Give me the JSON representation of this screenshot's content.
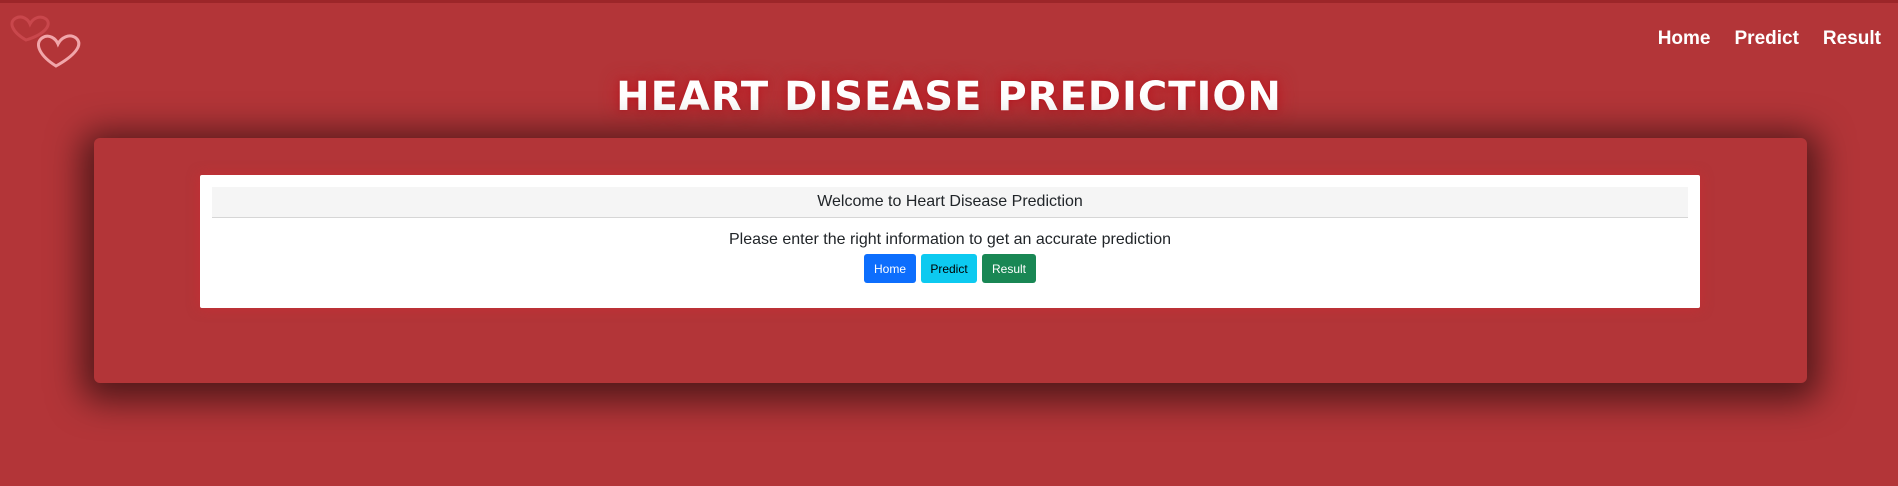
{
  "logo": {
    "icon": "heart-outline-icon"
  },
  "nav": {
    "items": [
      {
        "label": "Home"
      },
      {
        "label": "Predict"
      },
      {
        "label": "Result"
      }
    ]
  },
  "page": {
    "title": "HEART DISEASE PREDICTION"
  },
  "card": {
    "header": "Welcome to Heart Disease Prediction",
    "text": "Please enter the right information to get an accurate prediction",
    "buttons": [
      {
        "label": "Home",
        "color": "#0d6efd"
      },
      {
        "label": "Predict",
        "color": "#0dcaf0"
      },
      {
        "label": "Result",
        "color": "#198754"
      }
    ]
  },
  "colors": {
    "background": "#b33538",
    "panel": "#b33538",
    "card": "#ffffff"
  }
}
